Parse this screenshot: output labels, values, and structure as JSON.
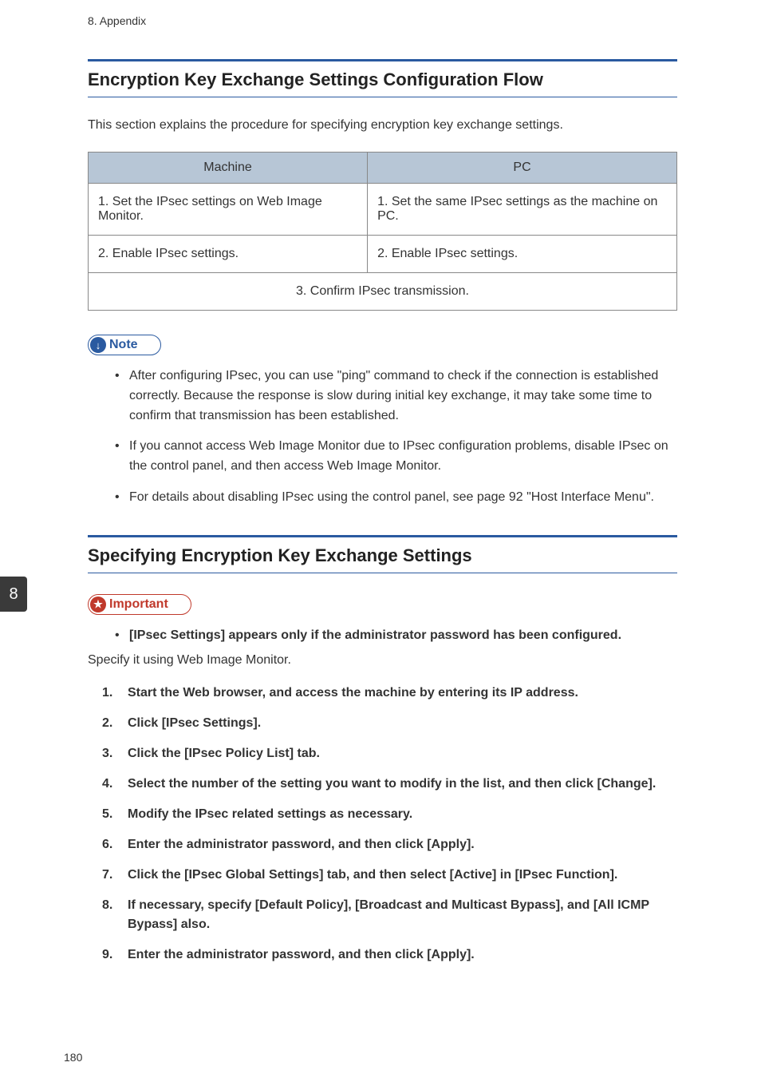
{
  "header": {
    "chapter": "8. Appendix"
  },
  "section1": {
    "title": "Encryption Key Exchange Settings Configuration Flow",
    "intro": "This section explains the procedure for specifying encryption key exchange settings.",
    "table": {
      "head_machine": "Machine",
      "head_pc": "PC",
      "r1_machine": "1. Set the IPsec settings on Web Image Monitor.",
      "r1_pc": "1. Set the same IPsec settings as the machine on PC.",
      "r2_machine": "2. Enable IPsec settings.",
      "r2_pc": "2. Enable IPsec settings.",
      "r3_merged": "3. Confirm IPsec transmission."
    },
    "note_label": "Note",
    "notes": [
      "After configuring IPsec, you can use \"ping\" command to check if the connection is established correctly. Because the response is slow during initial key exchange, it may take some time to confirm that transmission has been established.",
      "If you cannot access Web Image Monitor due to IPsec configuration problems, disable IPsec on the control panel, and then access Web Image Monitor.",
      "For details about disabling IPsec using the control panel, see page 92 \"Host Interface Menu\"."
    ]
  },
  "section2": {
    "title": "Specifying Encryption Key Exchange Settings",
    "important_label": "Important",
    "important_items": [
      "[IPsec Settings] appears only if the administrator password has been configured."
    ],
    "plain": "Specify it using Web Image Monitor.",
    "steps": [
      "Start the Web browser, and access the machine by entering its IP address.",
      "Click [IPsec Settings].",
      "Click the [IPsec Policy List] tab.",
      "Select the number of the setting you want to modify in the list, and then click [Change].",
      "Modify the IPsec related settings as necessary.",
      "Enter the administrator password, and then click [Apply].",
      "Click the [IPsec Global Settings] tab, and then select [Active] in [IPsec Function].",
      "If necessary, specify [Default Policy], [Broadcast and Multicast Bypass], and [All ICMP Bypass] also.",
      "Enter the administrator password, and then click [Apply]."
    ]
  },
  "side_tab": "8",
  "page_number": "180"
}
